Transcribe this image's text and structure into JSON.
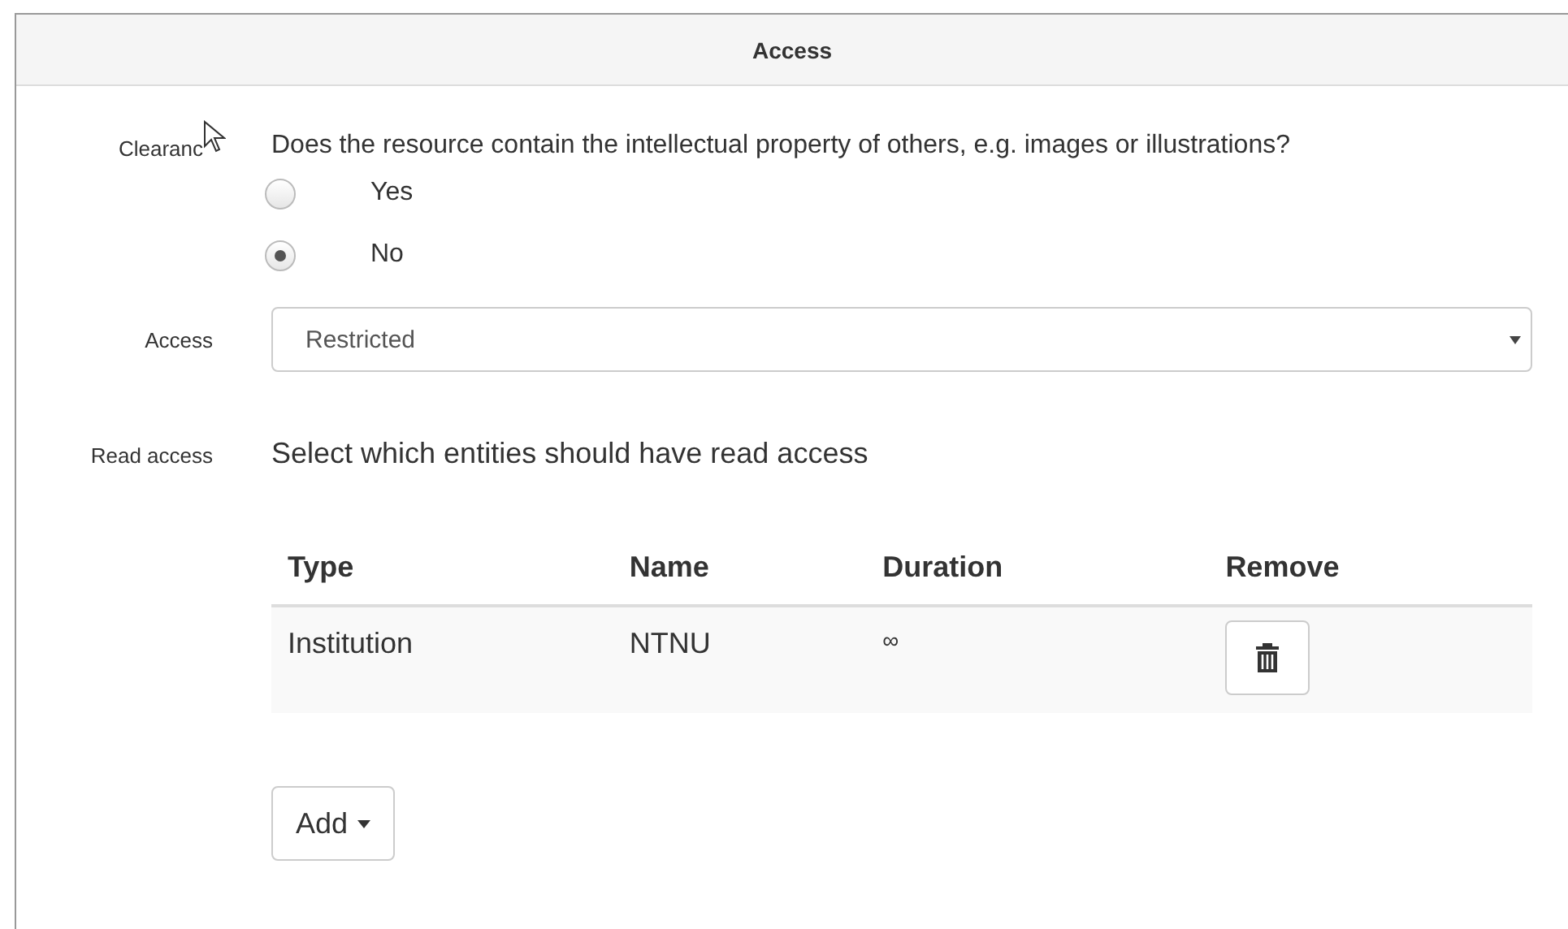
{
  "panel": {
    "title": "Access"
  },
  "clearance": {
    "label": "Clearanc",
    "question": "Does the resource contain the intellectual property of others, e.g. images or illustrations?",
    "options": [
      {
        "label": "Yes",
        "selected": false
      },
      {
        "label": "No",
        "selected": true
      }
    ]
  },
  "access": {
    "label": "Access",
    "value": "Restricted"
  },
  "read_access": {
    "label": "Read access",
    "description": "Select which entities should have read access",
    "table": {
      "columns": [
        "Type",
        "Name",
        "Duration",
        "Remove"
      ],
      "rows": [
        {
          "type": "Institution",
          "name": "NTNU",
          "duration": "∞"
        }
      ]
    },
    "add_button": "Add"
  }
}
